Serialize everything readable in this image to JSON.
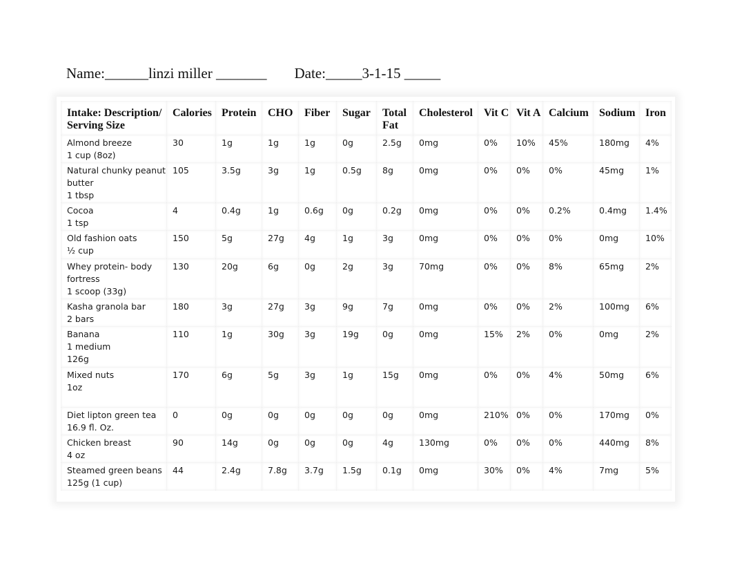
{
  "header": {
    "name_label": "Name:",
    "name_prefix_blank": "______",
    "name_value": "linzi miller",
    "name_suffix_blank": " _______",
    "date_label": "Date:",
    "date_prefix_blank": "_____",
    "date_value": "3-1-15",
    "date_suffix_blank": " _____"
  },
  "table": {
    "columns": [
      "Intake: Description/Serving Size",
      "Calories",
      "Protein",
      "CHO",
      "Fiber",
      "Sugar",
      "Total Fat",
      "Cholesterol",
      "Vit C",
      "Vit A",
      "Calcium",
      "Sodium",
      "Iron"
    ],
    "rows": [
      {
        "food": [
          "Almond breeze",
          "1 cup (8oz)"
        ],
        "values": [
          "30",
          "1g",
          "1g",
          "1g",
          "0g",
          "2.5g",
          "0mg",
          "0%",
          "10%",
          "45%",
          "180mg",
          "4%"
        ]
      },
      {
        "food": [
          "Natural chunky peanut butter",
          "1 tbsp"
        ],
        "values": [
          "105",
          "3.5g",
          "3g",
          "1g",
          "0.5g",
          "8g",
          "0mg",
          "0%",
          "0%",
          "0%",
          "45mg",
          "1%"
        ]
      },
      {
        "food": [
          "Cocoa",
          "1 tsp"
        ],
        "values": [
          "4",
          "0.4g",
          "1g",
          "0.6g",
          "0g",
          "0.2g",
          "0mg",
          "0%",
          "0%",
          "0.2%",
          "0.4mg",
          "1.4%"
        ]
      },
      {
        "food": [
          "Old fashion oats",
          "½ cup"
        ],
        "values": [
          "150",
          "5g",
          "27g",
          "4g",
          "1g",
          "3g",
          "0mg",
          "0%",
          "0%",
          "0%",
          "0mg",
          "10%"
        ]
      },
      {
        "food": [
          "Whey protein- body fortress",
          "1 scoop (33g)"
        ],
        "values": [
          "130",
          "20g",
          "6g",
          "0g",
          "2g",
          "3g",
          "70mg",
          "0%",
          "0%",
          "8%",
          "65mg",
          "2%"
        ]
      },
      {
        "food": [
          "Kasha granola bar",
          "2 bars"
        ],
        "values": [
          "180",
          "3g",
          "27g",
          "3g",
          "9g",
          "7g",
          "0mg",
          "0%",
          "0%",
          "2%",
          "100mg",
          "6%"
        ]
      },
      {
        "food": [
          "Banana",
          "1 medium",
          "126g"
        ],
        "values": [
          "110",
          "1g",
          "30g",
          "3g",
          "19g",
          "0g",
          "0mg",
          "15%",
          "2%",
          "0%",
          "0mg",
          "2%"
        ]
      },
      {
        "food": [
          "Mixed nuts",
          "1oz"
        ],
        "values": [
          "170",
          "6g",
          "5g",
          "3g",
          "1g",
          "15g",
          "0mg",
          "0%",
          "0%",
          "4%",
          "50mg",
          "6%"
        ]
      },
      {
        "food": [
          "Diet lipton green tea",
          "16.9 fl. Oz."
        ],
        "values": [
          "0",
          "0g",
          "0g",
          "0g",
          "0g",
          "0g",
          "0mg",
          "210%",
          "0%",
          "0%",
          "170mg",
          "0%"
        ]
      },
      {
        "food": [
          "Chicken breast",
          "4 oz"
        ],
        "values": [
          "90",
          "14g",
          "0g",
          "0g",
          "0g",
          "4g",
          "130mg",
          "0%",
          "0%",
          "0%",
          "440mg",
          "8%"
        ]
      },
      {
        "food": [
          "Steamed green beans",
          "125g (1 cup)"
        ],
        "values": [
          "44",
          "2.4g",
          "7.8g",
          "3.7g",
          "1.5g",
          "0.1g",
          "0mg",
          "30%",
          "0%",
          "4%",
          "7mg",
          "5%"
        ]
      }
    ]
  }
}
